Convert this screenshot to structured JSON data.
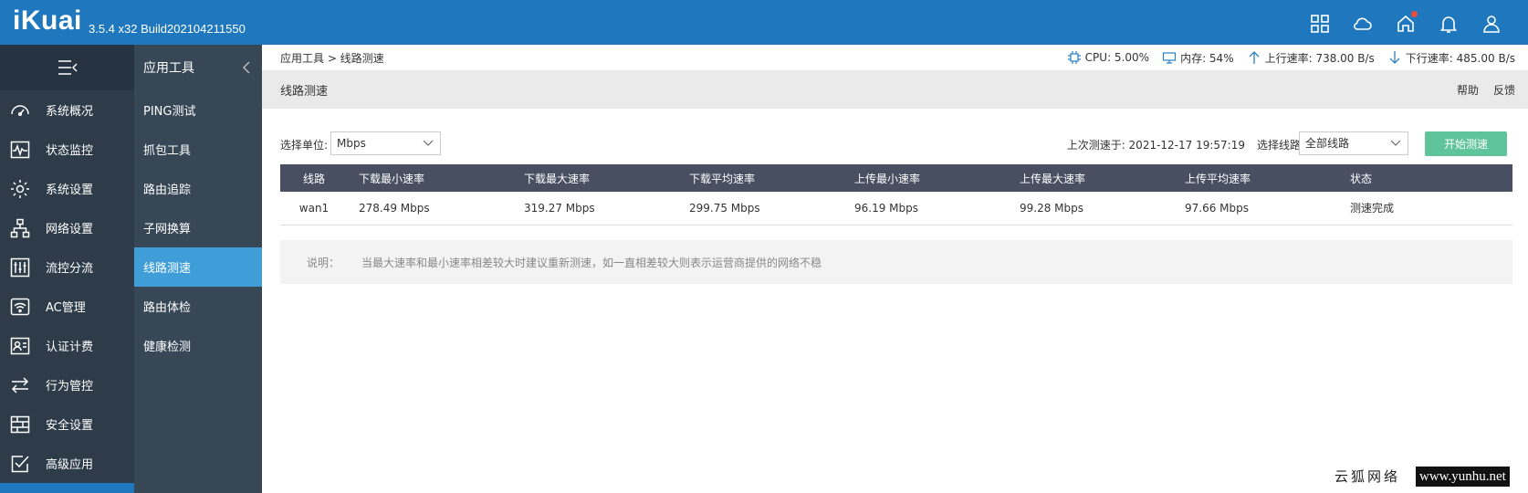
{
  "header": {
    "logo": "iKuai",
    "version": "3.5.4 x32 Build202104211550"
  },
  "sidebar": {
    "items": [
      {
        "label": "系统概况",
        "icon": "gauge-icon"
      },
      {
        "label": "状态监控",
        "icon": "monitor-wave-icon"
      },
      {
        "label": "系统设置",
        "icon": "gear-icon"
      },
      {
        "label": "网络设置",
        "icon": "network-icon"
      },
      {
        "label": "流控分流",
        "icon": "sliders-icon"
      },
      {
        "label": "AC管理",
        "icon": "wifi-icon"
      },
      {
        "label": "认证计费",
        "icon": "id-card-icon"
      },
      {
        "label": "行为管控",
        "icon": "arrows-swap-icon"
      },
      {
        "label": "安全设置",
        "icon": "firewall-icon"
      },
      {
        "label": "高级应用",
        "icon": "checkbox-icon"
      }
    ]
  },
  "subnav": {
    "title": "应用工具",
    "items": [
      "PING测试",
      "抓包工具",
      "路由追踪",
      "子网换算",
      "线路测速",
      "路由体检",
      "健康检测"
    ],
    "active_index": 4
  },
  "breadcrumb": "应用工具 > 线路测速",
  "status": {
    "cpu": "CPU: 5.00%",
    "memory": "内存: 54%",
    "upload": "上行速率: 738.00 B/s",
    "download": "下行速率: 485.00 B/s"
  },
  "page": {
    "title": "线路测速",
    "help": "帮助",
    "feedback": "反馈"
  },
  "toolbar": {
    "unit_label": "选择单位:",
    "unit_value": "Mbps",
    "last_test": "上次测速于: 2021-12-17 19:57:19",
    "line_label": "选择线路:",
    "line_value": "全部线路",
    "start_button": "开始测速"
  },
  "table": {
    "headers": [
      "线路",
      "下载最小速率",
      "下载最大速率",
      "下载平均速率",
      "上传最小速率",
      "上传最大速率",
      "上传平均速率",
      "状态"
    ],
    "rows": [
      [
        "wan1",
        "278.49 Mbps",
        "319.27 Mbps",
        "299.75 Mbps",
        "96.19 Mbps",
        "99.28 Mbps",
        "97.66 Mbps",
        "测速完成"
      ]
    ]
  },
  "note": {
    "key": "说明：",
    "text": "当最大速率和最小速率相差较大时建议重新测速，如一直相差较大则表示运营商提供的网络不稳"
  },
  "watermark": {
    "cn": "云狐网络",
    "url": "www.yunhu.net"
  }
}
